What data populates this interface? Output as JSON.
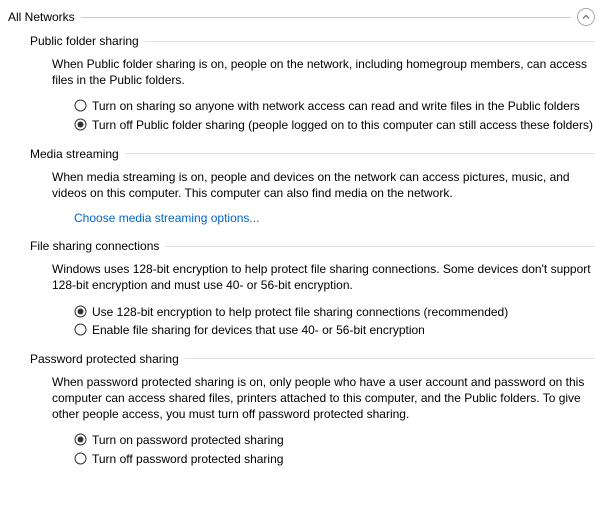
{
  "header": {
    "title": "All Networks"
  },
  "sections": {
    "public_folder_sharing": {
      "title": "Public folder sharing",
      "description": "When Public folder sharing is on, people on the network, including homegroup members, can access files in the Public folders.",
      "option_on": "Turn on sharing so anyone with network access can read and write files in the Public folders",
      "option_off": "Turn off Public folder sharing (people logged on to this computer can still access these folders)",
      "selected": "off"
    },
    "media_streaming": {
      "title": "Media streaming",
      "description": "When media streaming is on, people and devices on the network can access pictures, music, and videos on this computer. This computer can also find media on the network.",
      "link": "Choose media streaming options..."
    },
    "file_sharing_connections": {
      "title": "File sharing connections",
      "description": "Windows uses 128-bit encryption to help protect file sharing connections. Some devices don't support 128-bit encryption and must use 40- or 56-bit encryption.",
      "option_128": "Use 128-bit encryption to help protect file sharing connections (recommended)",
      "option_4056": "Enable file sharing for devices that use 40- or 56-bit encryption",
      "selected": "128"
    },
    "password_protected_sharing": {
      "title": "Password protected sharing",
      "description": "When password protected sharing is on, only people who have a user account and password on this computer can access shared files, printers attached to this computer, and the Public folders. To give other people access, you must turn off password protected sharing.",
      "option_on": "Turn on password protected sharing",
      "option_off": "Turn off password protected sharing",
      "selected": "on"
    }
  }
}
